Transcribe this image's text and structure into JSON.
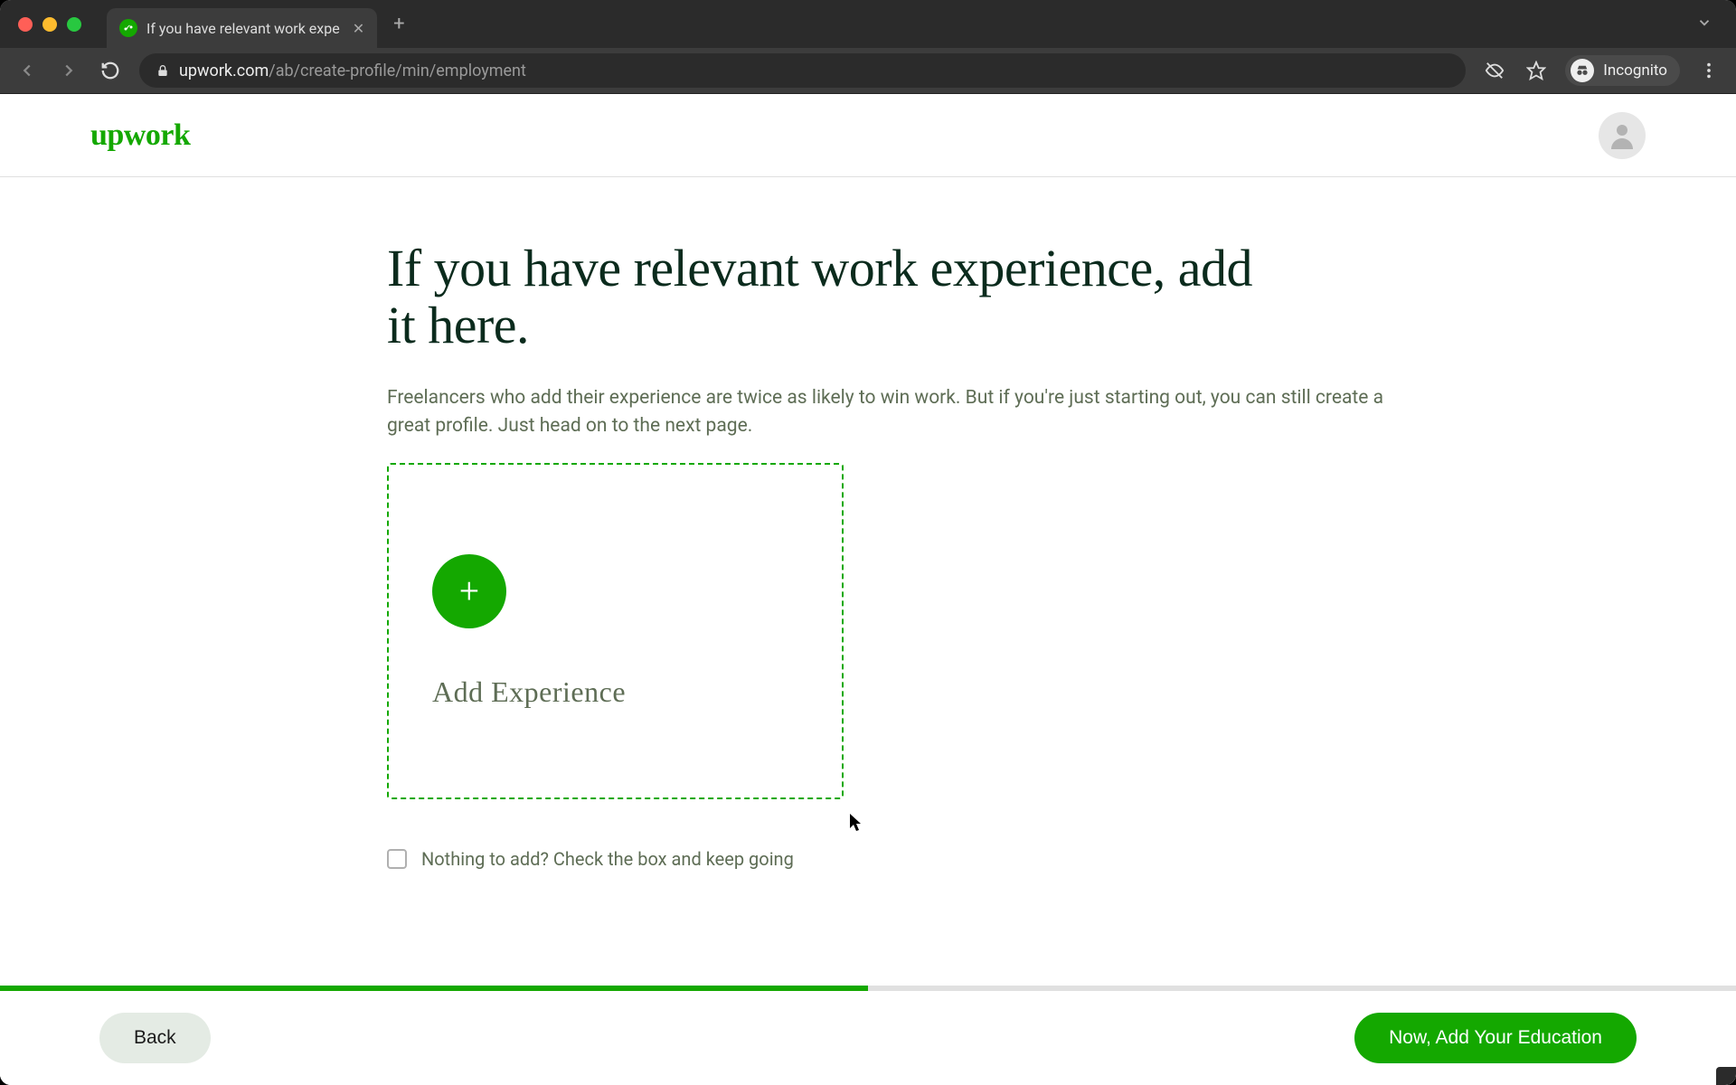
{
  "browser": {
    "tab_title": "If you have relevant work expe",
    "url_host": "upwork.com",
    "url_path": "/ab/create-profile/min/employment",
    "incognito_label": "Incognito"
  },
  "app": {
    "logo_text": "upwork"
  },
  "page": {
    "heading": "If you have relevant work experience, add it here.",
    "subtext": "Freelancers who add their experience are twice as likely to win work. But if you're just starting out, you can still create a great profile. Just head on to the next page.",
    "add_card_label": "Add Experience",
    "checkbox_label": "Nothing to add? Check the box and keep going",
    "progress_percent": 50
  },
  "footer": {
    "back_label": "Back",
    "next_label": "Now, Add Your Education"
  },
  "colors": {
    "brand_green": "#14a800",
    "heading_dark": "#0b2b1d",
    "muted_text": "#5e6d55"
  }
}
